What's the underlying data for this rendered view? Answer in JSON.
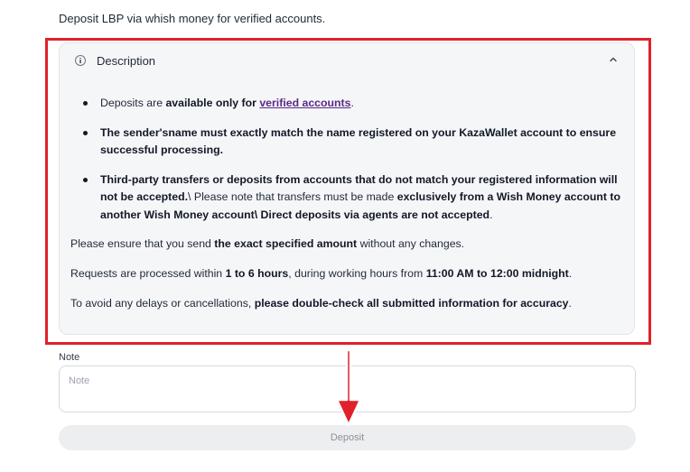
{
  "intro_text": "Deposit LBP via whish money for verified accounts.",
  "description": {
    "title": "Description",
    "bullet1": {
      "pre": "Deposits are ",
      "bold": "available only for",
      "link": "verified accounts",
      "post": "."
    },
    "bullet2": {
      "bold": "The sender'sname must exactly match the name registered on your KazaWallet account to ensure successful processing."
    },
    "bullet3": {
      "bold1": "Third-party transfers or deposits from accounts that do not match your registered information will not be accepted.",
      "text1": "\\ Please note that transfers must be made ",
      "bold2": "exclusively from a Wish Money account to another Wish Money account\\ Direct deposits via agents are not accepted",
      "post": "."
    },
    "para1": {
      "pre": "Please ensure that you send ",
      "bold": "the exact specified amount",
      "post": " without any changes."
    },
    "para2": {
      "pre": "Requests are processed within ",
      "bold1": "1 to 6 hours",
      "mid": ", during working hours from ",
      "bold2": "11:00 AM to 12:00 midnight",
      "post": "."
    },
    "para3": {
      "pre": "To avoid any delays or cancellations, ",
      "bold": "please double-check all submitted information for accuracy",
      "post": "."
    }
  },
  "note": {
    "label": "Note",
    "placeholder": "Note",
    "value": ""
  },
  "deposit_button": {
    "label": "Deposit"
  },
  "icons": {
    "info": "info-icon",
    "chevron": "chevron-up-icon"
  },
  "colors": {
    "highlight": "#e0212a",
    "link": "#5b2a86"
  }
}
